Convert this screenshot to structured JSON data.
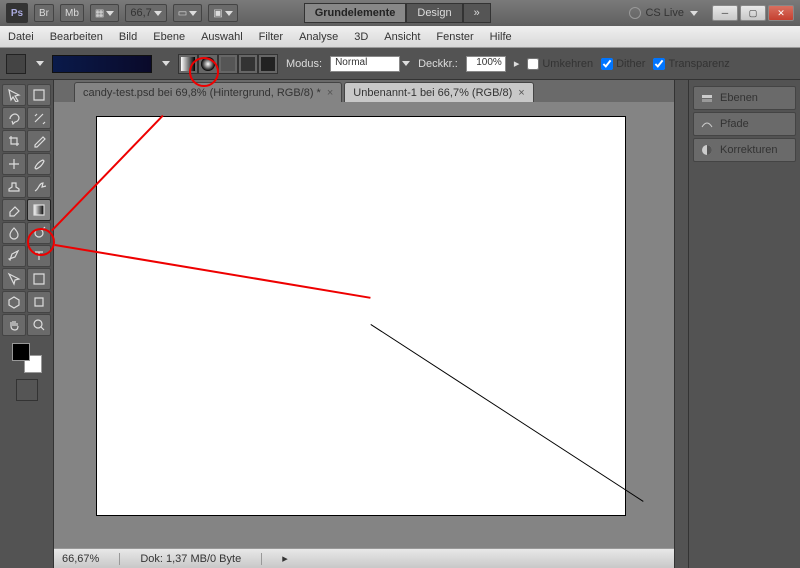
{
  "title": {
    "ps": "Ps",
    "br": "Br",
    "mb": "Mb",
    "zoom": "66,7",
    "workspace_active": "Grundelemente",
    "workspace2": "Design",
    "cslive": "CS Live"
  },
  "menu": [
    "Datei",
    "Bearbeiten",
    "Bild",
    "Ebene",
    "Auswahl",
    "Filter",
    "Analyse",
    "3D",
    "Ansicht",
    "Fenster",
    "Hilfe"
  ],
  "opt": {
    "mode_label": "Modus:",
    "mode_value": "Normal",
    "opacity_label": "Deckkr.:",
    "opacity_value": "100%",
    "reverse": "Umkehren",
    "dither": "Dither",
    "transp": "Transparenz"
  },
  "tabs": [
    {
      "label": "candy-test.psd bei 69,8% (Hintergrund, RGB/8) *",
      "active": false
    },
    {
      "label": "Unbenannt-1 bei 66,7% (RGB/8)",
      "active": true
    }
  ],
  "status": {
    "zoom": "66,67%",
    "doc": "Dok: 1,37 MB/0 Byte"
  },
  "panels": [
    {
      "label": "Ebenen",
      "icon": "layers"
    },
    {
      "label": "Pfade",
      "icon": "paths"
    },
    {
      "label": "Korrekturen",
      "icon": "adjust"
    }
  ],
  "tools": [
    [
      "move",
      "marquee"
    ],
    [
      "lasso",
      "wand"
    ],
    [
      "crop",
      "eyedrop"
    ],
    [
      "heal",
      "brush"
    ],
    [
      "stamp",
      "history"
    ],
    [
      "eraser",
      "gradient"
    ],
    [
      "blur",
      "dodge"
    ],
    [
      "pen",
      "type"
    ],
    [
      "path",
      "shape"
    ],
    [
      "3d1",
      "3d2"
    ],
    [
      "hand",
      "zoom"
    ]
  ]
}
